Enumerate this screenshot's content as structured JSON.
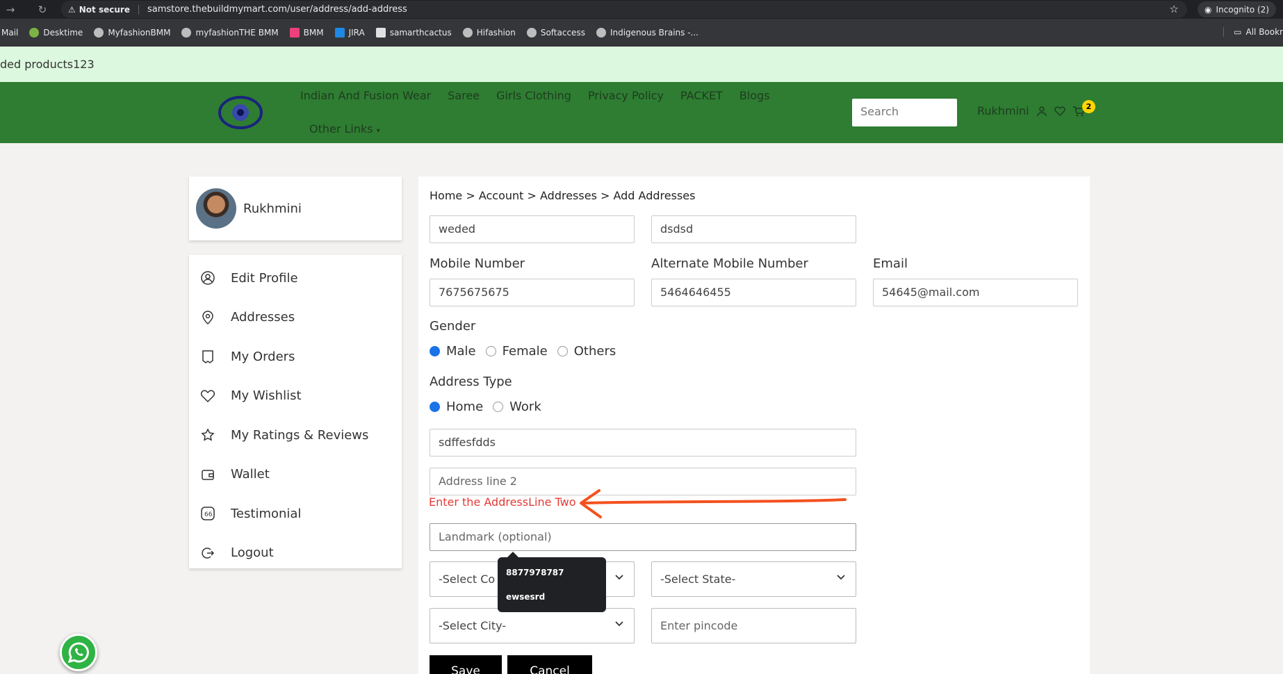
{
  "browser": {
    "not_secure_label": "Not secure",
    "url": "samstore.thebuildmymart.com/user/address/add-address",
    "incognito_label": "Incognito (2)",
    "bookmarks": [
      "Mail",
      "Desktime",
      "MyfashionBMM",
      "myfashionTHE BMM",
      "BMM",
      "JIRA",
      "samarthcactus",
      "Hifashion",
      "Softaccess",
      "Indigenous Brains -..."
    ],
    "all_bookmarks_label": "All Bookr"
  },
  "banner": {
    "text": "ded products123"
  },
  "nav": {
    "links": [
      "Indian And Fusion Wear",
      "Saree",
      "Girls Clothing",
      "Privacy Policy",
      "PACKET",
      "Blogs"
    ],
    "other_links": "Other Links",
    "search_placeholder": "Search",
    "username": "Rukhmini",
    "cart_count": "2",
    "bar_color": "#2e7d32"
  },
  "sidebar": {
    "name": "Rukhmini",
    "items": [
      {
        "label": "Edit Profile",
        "icon": "user-icon"
      },
      {
        "label": "Addresses",
        "icon": "location-icon"
      },
      {
        "label": "My Orders",
        "icon": "receipt-icon"
      },
      {
        "label": "My Wishlist",
        "icon": "heart-icon"
      },
      {
        "label": "My Ratings & Reviews",
        "icon": "star-icon"
      },
      {
        "label": "Wallet",
        "icon": "wallet-icon"
      },
      {
        "label": "Testimonial",
        "icon": "quote-icon"
      },
      {
        "label": "Logout",
        "icon": "logout-icon"
      }
    ]
  },
  "form": {
    "breadcrumb": "Home > Account > Addresses > Add Addresses",
    "first_name": "weded",
    "last_name": "dsdsd",
    "mobile_label": "Mobile Number",
    "mobile_value": "7675675675",
    "alt_mobile_label": "Alternate Mobile Number",
    "alt_mobile_value": "5464646455",
    "email_label": "Email",
    "email_value": "54645@mail.com",
    "gender_label": "Gender",
    "gender_options": [
      "Male",
      "Female",
      "Others"
    ],
    "gender_selected": "Male",
    "address_type_label": "Address Type",
    "address_type_options": [
      "Home",
      "Work"
    ],
    "address_type_selected": "Home",
    "address_line1": "sdffesfdds",
    "address_line2_placeholder": "Address line 2",
    "address_line2_error": "Enter the AddressLine Two",
    "landmark_placeholder": "Landmark (optional)",
    "country_placeholder": "-Select Co",
    "state_placeholder": "-Select State-",
    "city_placeholder": "-Select City-",
    "pincode_placeholder": "Enter pincode",
    "save_label": "Save",
    "cancel_label": "Cancel",
    "error_color": "#e53935"
  },
  "autocomplete": {
    "suggestions": [
      "8877978787",
      "ewsesrd"
    ]
  }
}
